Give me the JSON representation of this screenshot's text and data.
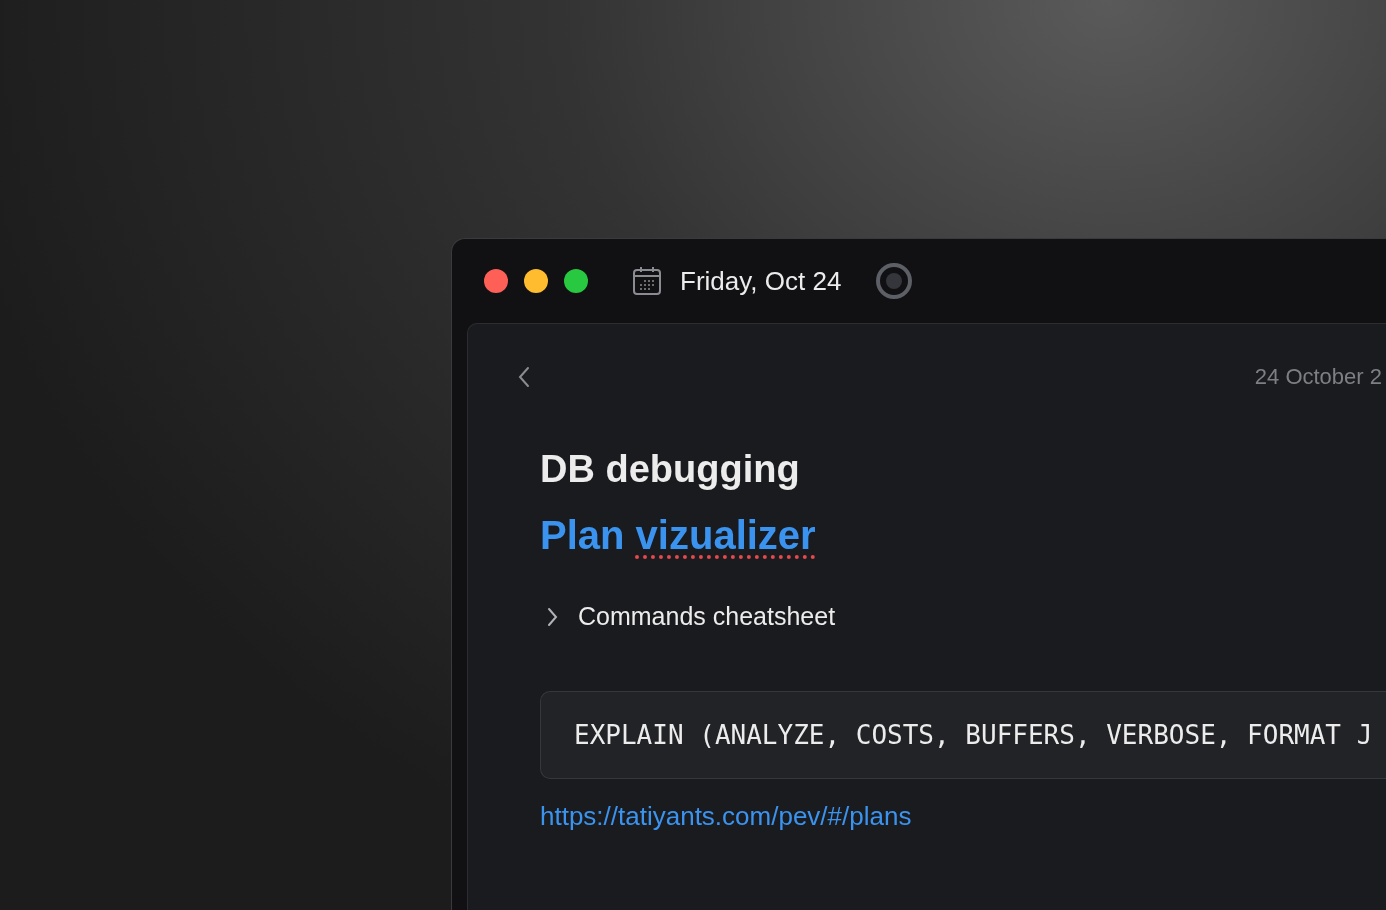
{
  "window": {
    "title": "Friday, Oct 24",
    "traffic_lights": [
      {
        "color": "#fe5f57"
      },
      {
        "color": "#febc2e"
      },
      {
        "color": "#28c840"
      }
    ]
  },
  "note": {
    "date": "24 October 2",
    "title": "DB debugging",
    "heading_link": {
      "parts": [
        {
          "text": "Plan ",
          "misspelled": false
        },
        {
          "text": "vizualizer",
          "misspelled": true
        }
      ]
    },
    "toggle": {
      "label": "Commands cheatsheet",
      "expanded": false
    },
    "code": "EXPLAIN (ANALYZE, COSTS, BUFFERS, VERBOSE, FORMAT J",
    "link": "https://tatiyants.com/pev/#/plans"
  }
}
